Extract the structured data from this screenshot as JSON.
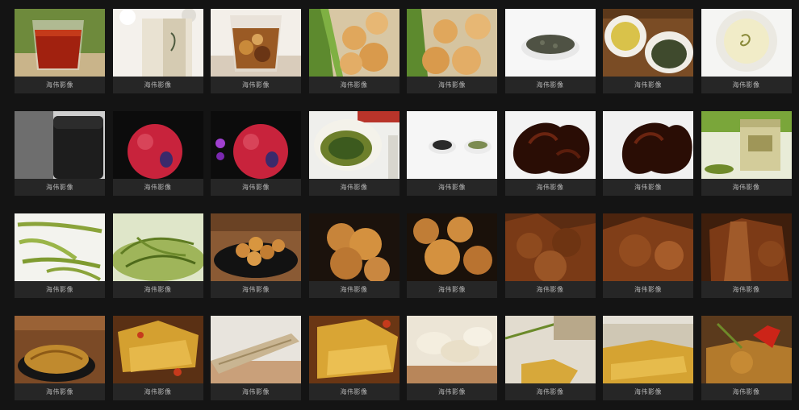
{
  "gallery": {
    "items": [
      {
        "caption": "海伟影像",
        "subject": "black-tea-glass"
      },
      {
        "caption": "海伟影像",
        "subject": "tea-gift-box"
      },
      {
        "caption": "海伟影像",
        "subject": "flower-tea-glass"
      },
      {
        "caption": "海伟影像",
        "subject": "pastry-plate"
      },
      {
        "caption": "海伟影像",
        "subject": "pastry-plate"
      },
      {
        "caption": "海伟影像",
        "subject": "green-tea-spoon"
      },
      {
        "caption": "海伟影像",
        "subject": "tea-cup-and-leaves"
      },
      {
        "caption": "海伟影像",
        "subject": "tea-cup-top"
      },
      {
        "caption": "海伟影像",
        "subject": "black-canister"
      },
      {
        "caption": "海伟影像",
        "subject": "red-apple"
      },
      {
        "caption": "海伟影像",
        "subject": "red-apple"
      },
      {
        "caption": "海伟影像",
        "subject": "green-tea-gaiwan"
      },
      {
        "caption": "海伟影像",
        "subject": "tea-dishes"
      },
      {
        "caption": "海伟影像",
        "subject": "wood-ear"
      },
      {
        "caption": "海伟影像",
        "subject": "wood-ear"
      },
      {
        "caption": "海伟影像",
        "subject": "tea-tin"
      },
      {
        "caption": "海伟影像",
        "subject": "tea-leaves-white"
      },
      {
        "caption": "海伟影像",
        "subject": "tea-leaves-green"
      },
      {
        "caption": "海伟影像",
        "subject": "dough-twist-bowl"
      },
      {
        "caption": "海伟影像",
        "subject": "dough-twist"
      },
      {
        "caption": "海伟影像",
        "subject": "dough-twist"
      },
      {
        "caption": "海伟影像",
        "subject": "dried-meat"
      },
      {
        "caption": "海伟影像",
        "subject": "dried-meat"
      },
      {
        "caption": "海伟影像",
        "subject": "dried-meat"
      },
      {
        "caption": "海伟影像",
        "subject": "shredded-bamboo-bowl"
      },
      {
        "caption": "海伟影像",
        "subject": "yellow-slices"
      },
      {
        "caption": "海伟影像",
        "subject": "dried-root"
      },
      {
        "caption": "海伟影像",
        "subject": "yellow-slices"
      },
      {
        "caption": "海伟影像",
        "subject": "white-slices"
      },
      {
        "caption": "海伟影像",
        "subject": "yellow-slices"
      },
      {
        "caption": "海伟影像",
        "subject": "yellow-slices"
      },
      {
        "caption": "海伟影像",
        "subject": "pepper-slices"
      }
    ]
  }
}
